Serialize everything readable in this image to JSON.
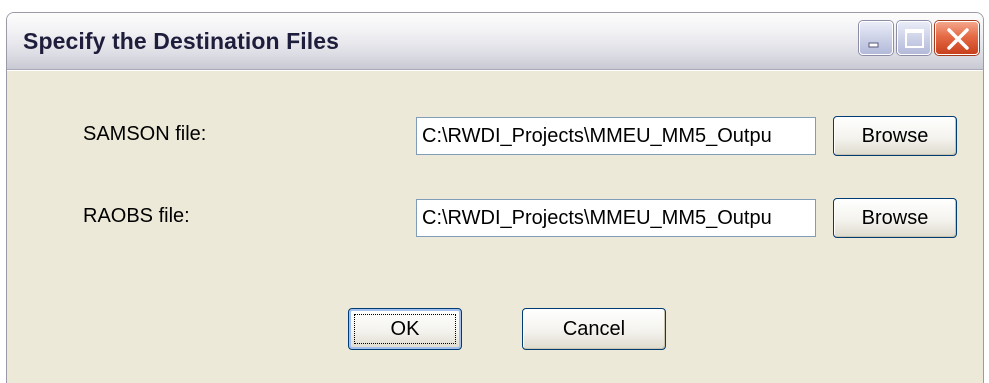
{
  "window": {
    "title": "Specify the Destination Files"
  },
  "controls": {
    "minimize_icon": "minimize-icon",
    "maximize_icon": "maximize-icon",
    "close_icon": "close-icon"
  },
  "fields": [
    {
      "label": "SAMSON file:",
      "value": "C:\\RWDI_Projects\\MMEU_MM5_Outpu",
      "button": "Browse"
    },
    {
      "label": "RAOBS file:",
      "value": "C:\\RWDI_Projects\\MMEU_MM5_Outpu",
      "button": "Browse"
    }
  ],
  "actions": {
    "ok_label": "OK",
    "cancel_label": "Cancel"
  },
  "colors": {
    "dialog_background": "#ece9d8",
    "close_button": "#e46a45",
    "input_border": "#7f9db9",
    "button_border": "#003c74"
  }
}
